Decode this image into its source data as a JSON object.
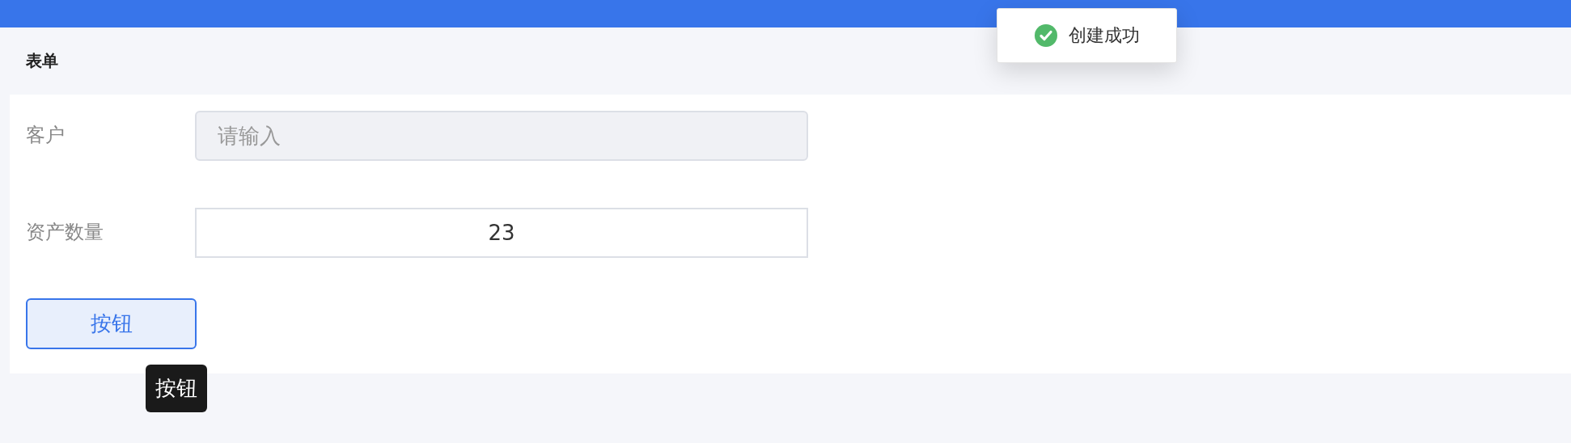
{
  "header": {
    "title": "表单"
  },
  "form": {
    "fields": [
      {
        "label": "客户",
        "placeholder": "请输入",
        "disabled": true
      },
      {
        "label": "资产数量",
        "value": "23",
        "disabled": false
      }
    ],
    "button": {
      "label": "按钮"
    },
    "tooltip": {
      "text": "按钮"
    }
  },
  "toast": {
    "kind": "success",
    "text": "创建成功"
  }
}
